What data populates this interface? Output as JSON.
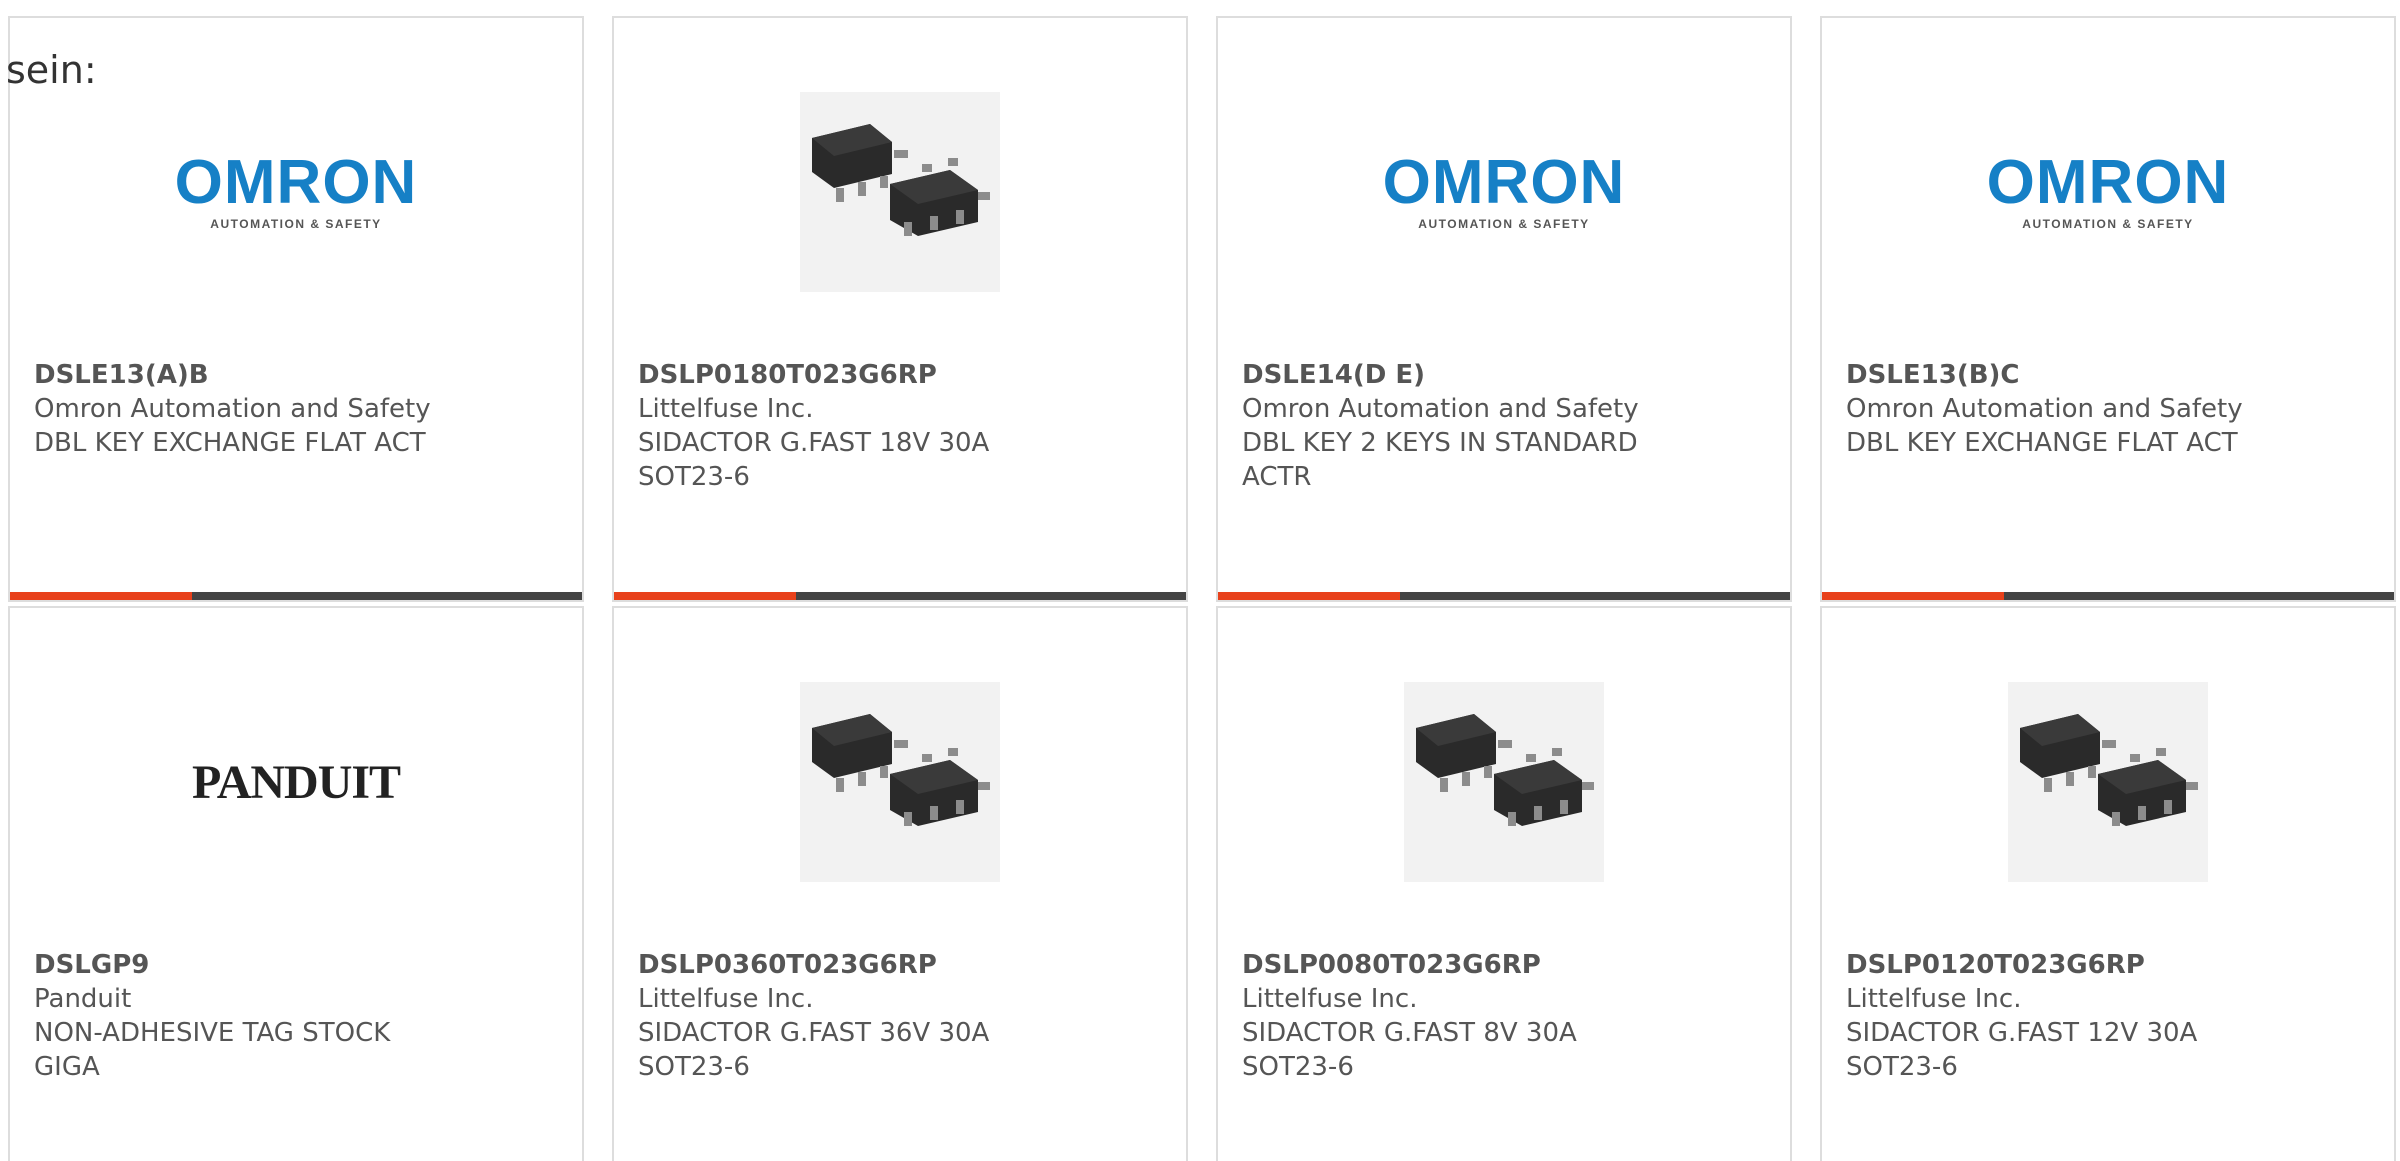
{
  "caption": "sein:",
  "colors": {
    "accent": "#e8411b",
    "bar": "#444444",
    "omron_blue": "#1680c6",
    "text": "#555555"
  },
  "cards": [
    {
      "image": "omron-logo",
      "logo_text": "OMRON",
      "logo_sub": "AUTOMATION & SAFETY",
      "part_number": "DSLE13(A)B",
      "manufacturer": "Omron Automation and Safety",
      "desc_line1": "DBL KEY EXCHANGE FLAT ACT",
      "desc_line2": ""
    },
    {
      "image": "sot23-chip-photo",
      "part_number": "DSLP0180T023G6RP",
      "manufacturer": "Littelfuse Inc.",
      "desc_line1": "SIDACTOR G.FAST 18V 30A",
      "desc_line2": "SOT23-6"
    },
    {
      "image": "omron-logo",
      "logo_text": "OMRON",
      "logo_sub": "AUTOMATION & SAFETY",
      "part_number": "DSLE14(D E)",
      "manufacturer": "Omron Automation and Safety",
      "desc_line1": "DBL KEY 2 KEYS IN STANDARD",
      "desc_line2": "ACTR"
    },
    {
      "image": "omron-logo",
      "logo_text": "OMRON",
      "logo_sub": "AUTOMATION & SAFETY",
      "part_number": "DSLE13(B)C",
      "manufacturer": "Omron Automation and Safety",
      "desc_line1": "DBL KEY EXCHANGE FLAT ACT",
      "desc_line2": ""
    },
    {
      "image": "panduit-logo",
      "logo_text": "PANDUIT",
      "part_number": "DSLGP9",
      "manufacturer": "Panduit",
      "desc_line1": "NON-ADHESIVE TAG STOCK",
      "desc_line2": "GIGA"
    },
    {
      "image": "sot23-chip-photo",
      "part_number": "DSLP0360T023G6RP",
      "manufacturer": "Littelfuse Inc.",
      "desc_line1": "SIDACTOR G.FAST 36V 30A",
      "desc_line2": "SOT23-6"
    },
    {
      "image": "sot23-chip-photo",
      "part_number": "DSLP0080T023G6RP",
      "manufacturer": "Littelfuse Inc.",
      "desc_line1": "SIDACTOR G.FAST 8V 30A",
      "desc_line2": "SOT23-6"
    },
    {
      "image": "sot23-chip-photo",
      "part_number": "DSLP0120T023G6RP",
      "manufacturer": "Littelfuse Inc.",
      "desc_line1": "SIDACTOR G.FAST 12V 30A",
      "desc_line2": "SOT23-6"
    }
  ]
}
